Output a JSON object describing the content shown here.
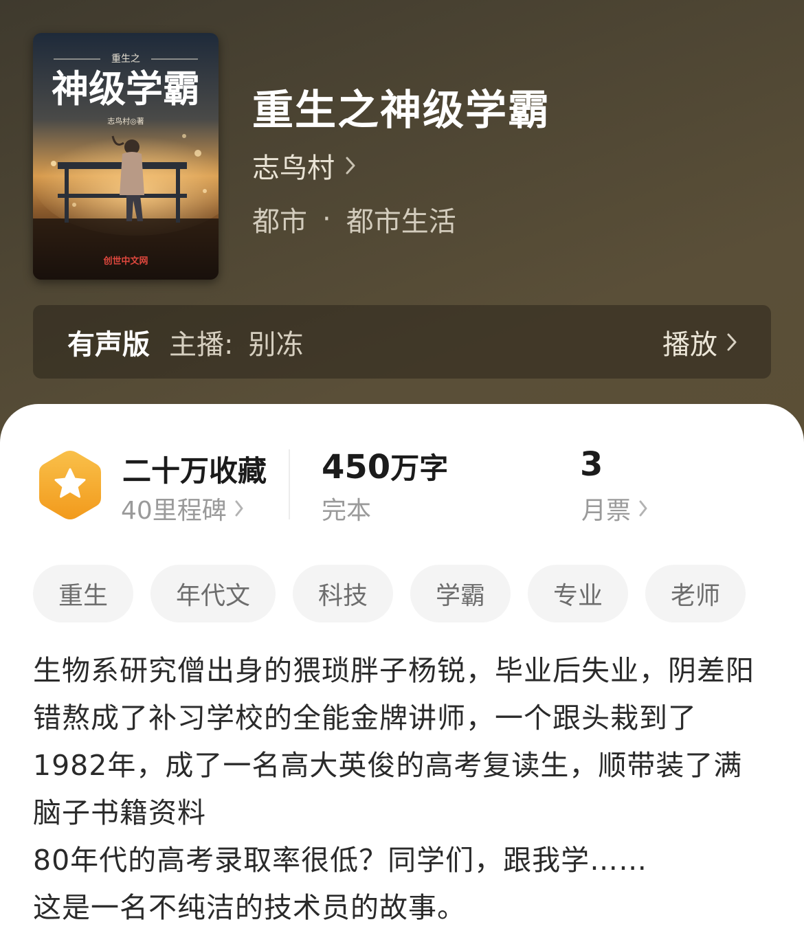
{
  "book": {
    "title": "重生之神级学霸",
    "author": "志鸟村",
    "category": "都市",
    "subcategory": "都市生活",
    "separator": "·",
    "cover": {
      "small_title": "重生之",
      "main_title": "神级学霸",
      "author_line": "志鸟村◎著",
      "publisher": "创世中文网"
    }
  },
  "audio": {
    "label": "有声版",
    "host_label": "主播:",
    "host_name": "别冻",
    "play_label": "播放"
  },
  "stats": {
    "favorites": "二十万收藏",
    "milestones": "40里程碑",
    "word_count_number": "450",
    "word_count_unit": "万字",
    "status": "完本",
    "monthly_votes": "3",
    "monthly_votes_label": "月票"
  },
  "tags": [
    "重生",
    "年代文",
    "科技",
    "学霸",
    "专业",
    "老师"
  ],
  "description": [
    "生物系研究僧出身的猥琐胖子杨锐，毕业后失业，阴差阳错熬成了补习学校的全能金牌讲师，一个跟头栽到了1982年，成了一名高大英俊的高考复读生，顺带装了满脑子书籍资料",
    "80年代的高考录取率很低？同学们，跟我学……",
    "这是一名不纯洁的技术员的故事。"
  ],
  "colors": {
    "header_bg": "#4d4533",
    "badge_orange": "#f5a623",
    "text_dark": "#1b1b1b",
    "text_muted": "#9a9a9a"
  }
}
